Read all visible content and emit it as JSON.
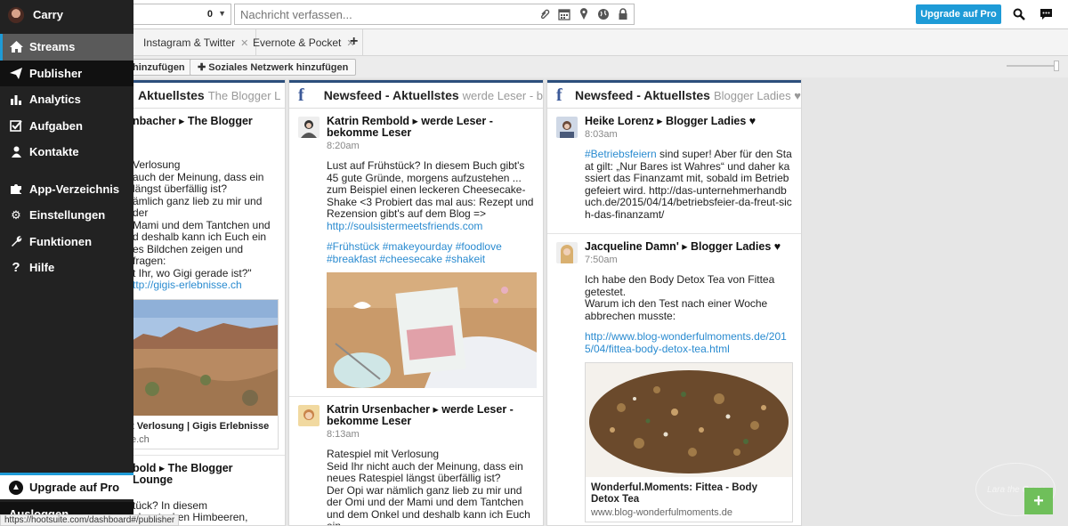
{
  "topbar": {
    "count": "0",
    "compose_placeholder": "Nachricht verfassen...",
    "upgrade_label": "Upgrade auf Pro",
    "icons": [
      "paperclip-icon",
      "calendar-icon",
      "location-icon",
      "globe-icon",
      "lock-icon"
    ]
  },
  "tabs": [
    {
      "label": "Instagram & Twitter"
    },
    {
      "label": "Evernote & Pocket"
    }
  ],
  "toolbar": {
    "add_stream_label": "hinzufügen",
    "add_network_label": "Soziales Netzwerk hinzufügen"
  },
  "sidebar": {
    "user": "Carry",
    "items": [
      {
        "label": "Streams",
        "icon": "home-icon"
      },
      {
        "label": "Publisher",
        "icon": "paper-plane-icon"
      },
      {
        "label": "Analytics",
        "icon": "bar-chart-icon"
      },
      {
        "label": "Aufgaben",
        "icon": "checkbox-icon"
      },
      {
        "label": "Kontakte",
        "icon": "person-icon"
      },
      {
        "label": "App-Verzeichnis",
        "icon": "puzzle-icon"
      },
      {
        "label": "Einstellungen",
        "icon": "gear-icon"
      },
      {
        "label": "Funktionen",
        "icon": "wrench-icon"
      },
      {
        "label": "Hilfe",
        "icon": "question-icon"
      }
    ],
    "upgrade_label": "Upgrade auf Pro",
    "bottom_label": "Ausloggen"
  },
  "status_url": "https://hootsuite.com/dashboard#/publisher",
  "columns": [
    {
      "title": "Aktuellstes",
      "subtitle": "The Blogger L",
      "posts": [
        {
          "author": "nbacher ▸ The Blogger",
          "body": "Verlosung\nauch der Meinung, dass ein\nlängst überfällig ist?\nämlich ganz lieb zu mir und der\nMami und dem Tantchen und\nd deshalb kann ich Euch ein\nes Bildchen zeigen und fragen:\nt Ihr, wo Gigi gerade ist?\"",
          "link": "ttp://gigis-erlebnisse.ch",
          "card_title": "t Verlosung | Gigis Erlebnisse",
          "card_url": "e.ch"
        },
        {
          "author": "bold ▸ The Blogger Lounge",
          "body": "tück? In diesem\nake stecken Himbeeren,\nErdbeeren, Frischkäse ... so"
        }
      ]
    },
    {
      "title": "Newsfeed - Aktuellstes",
      "subtitle": "werde Leser - b",
      "posts": [
        {
          "author": "Katrin Rembold ▸ werde Leser - bekomme Leser",
          "time": "8:20am",
          "body": "Lust auf Frühstück? In diesem Buch gibt's 45 gute Gründe, morgens aufzustehen ... zum Beispiel einen leckeren Cheesecake-Shake <3 Probiert das mal aus: Rezept und Rezension gibt's auf dem Blog =>",
          "link": "http://soulsistermeetsfriends.com",
          "tags": "#Frühstück #makeyourday #foodlove #breakfast #cheesecake #shakeit"
        },
        {
          "author": "Katrin Ursenbacher ▸ werde Leser - bekomme Leser",
          "time": "8:13am",
          "body": "Ratespiel mit Verlosung\nSeid Ihr nicht auch der Meinung, dass ein neues Ratespiel längst überfällig ist?\nDer Opi war nämlich ganz lieb zu mir und der Omi und der Mami und dem Tantchen und dem Onkel und deshalb kann ich Euch ein"
        }
      ]
    },
    {
      "title": "Newsfeed - Aktuellstes",
      "subtitle": "Blogger Ladies ♥",
      "posts": [
        {
          "author": "Heike Lorenz ▸ Blogger Ladies ♥",
          "time": "8:03am",
          "hashtag": "#Betriebsfeiern",
          "body": " sind super! Aber für den Staat gilt: „Nur Bares ist Wahres“ und daher kassiert das Finanzamt mit, sobald im Betrieb gefeiert wird. http://das-unternehmerhandbuch.de/2015/04/14/betriebsfeier-da-freut-sich-das-finanzamt/"
        },
        {
          "author": "Jacqueline Damn' ▸ Blogger Ladies ♥",
          "time": "7:50am",
          "body": "Ich habe den Body Detox Tea von Fittea getestet.\nWarum ich den Test nach einer Woche abbrechen musste:",
          "link": "http://www.blog-wonderfulmoments.de/2015/04/fittea-body-detox-tea.html",
          "card_title": "Wonderful.Moments: Fittea - Body Detox Tea",
          "card_url": "www.blog-wonderfulmoments.de"
        }
      ]
    }
  ],
  "colors": {
    "accent": "#1e9bd7",
    "sidebar": "#222222",
    "facebook": "#3b5998",
    "link": "#2a8bd0"
  }
}
